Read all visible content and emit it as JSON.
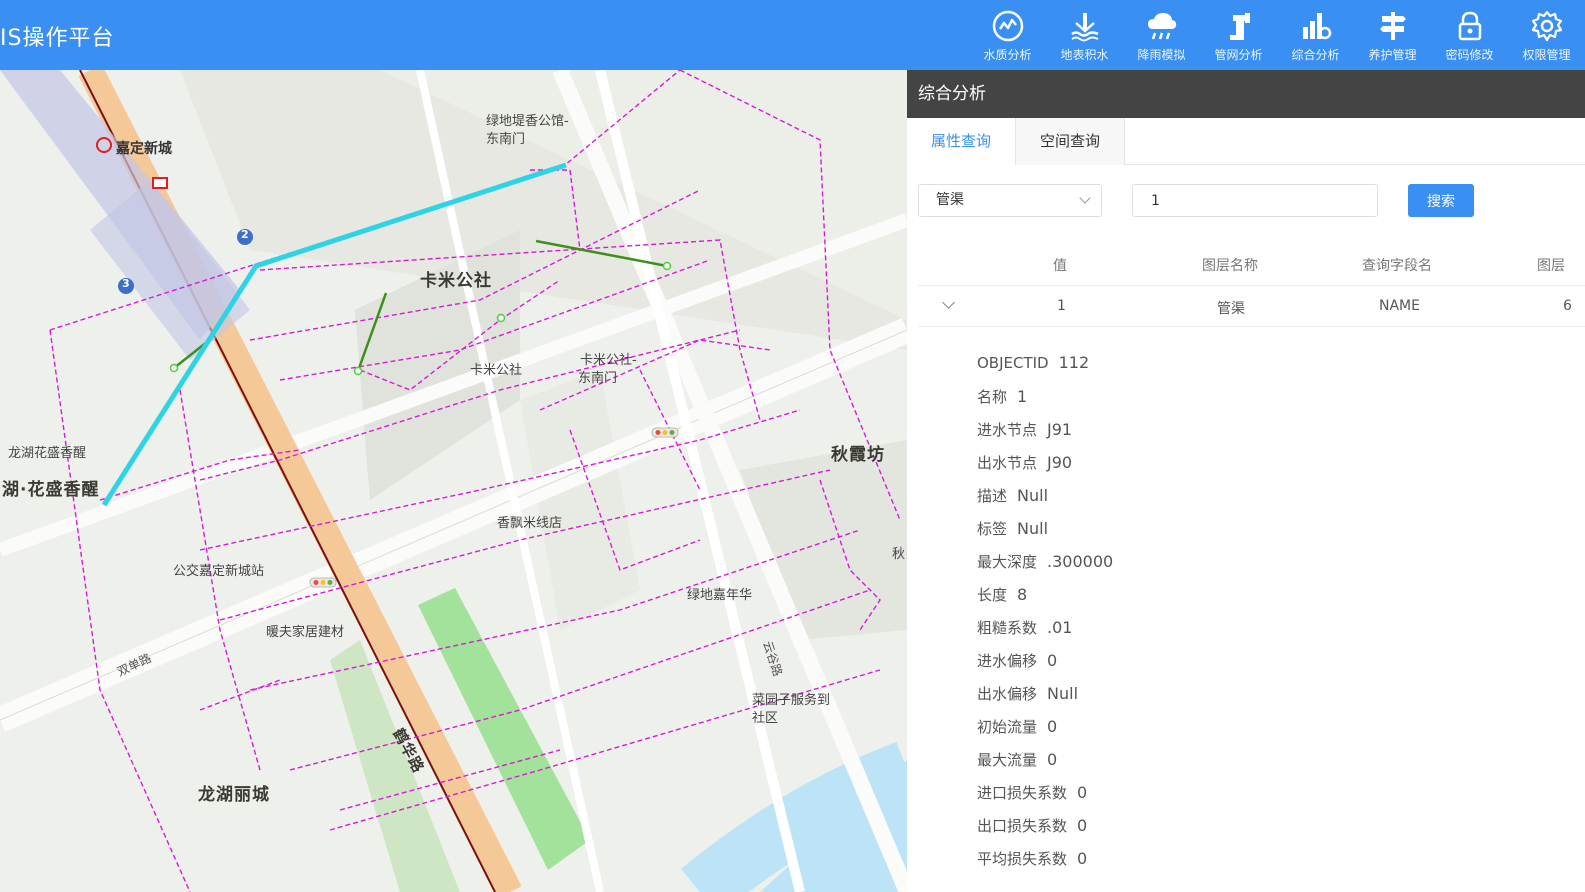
{
  "header": {
    "title": "IS操作平台",
    "nav": [
      {
        "label": "水质分析",
        "icon": "water-quality-icon"
      },
      {
        "label": "地表积水",
        "icon": "surface-water-icon"
      },
      {
        "label": "降雨模拟",
        "icon": "rain-cloud-icon"
      },
      {
        "label": "管网分析",
        "icon": "pipe-network-icon"
      },
      {
        "label": "综合分析",
        "icon": "chart-analysis-icon"
      },
      {
        "label": "养护管理",
        "icon": "signpost-icon"
      },
      {
        "label": "密码修改",
        "icon": "lock-icon"
      },
      {
        "label": "权限管理",
        "icon": "gear-icon"
      }
    ]
  },
  "map": {
    "labels": {
      "jiading_xincheng": "嘉定新城",
      "lvdi_guild": "绿地堤香公馆-",
      "lvdi_guild_gate": "东南门",
      "kami_big": "卡米公社",
      "kami_small": "卡米公社",
      "kami_gate1": "卡米公社-",
      "kami_gate2": "东南门",
      "qiuxia": "秋霞坊",
      "longhu_small": "龙湖花盛香醒",
      "longhu_big": "湖·花盛香醒",
      "xiangpiao": "香飘米线店",
      "bus_station": "公交嘉定新城站",
      "nuanfu": "暖夫家居建材",
      "lvdi_carnival": "绿地嘉年华",
      "caiyuan1": "菜园子服务到",
      "caiyuan2": "社区",
      "shuangdan_rd": "双单路",
      "yunqiu_rd": "云谷路",
      "hehua_rd": "鹤华路",
      "longhu_lily": "龙湖丽城",
      "qiu_edge": "秋",
      "metro_2": "2",
      "metro_3": "3"
    }
  },
  "panel": {
    "title": "综合分析",
    "tabs": [
      "属性查询",
      "空间查询"
    ],
    "layer_select": "管渠",
    "query_value": "1",
    "search_label": "搜索",
    "columns": [
      "值",
      "图层名称",
      "查询字段名",
      "图层"
    ],
    "row": {
      "value": "1",
      "layer": "管渠",
      "field": "NAME",
      "extra": "6"
    },
    "attributes": [
      {
        "k": "OBJECTID",
        "v": "112"
      },
      {
        "k": "名称",
        "v": "1"
      },
      {
        "k": "进水节点",
        "v": "J91"
      },
      {
        "k": "出水节点",
        "v": "J90"
      },
      {
        "k": "描述",
        "v": "Null"
      },
      {
        "k": "标签",
        "v": "Null"
      },
      {
        "k": "最大深度",
        "v": ".300000"
      },
      {
        "k": "长度",
        "v": "8"
      },
      {
        "k": "粗糙系数",
        "v": ".01"
      },
      {
        "k": "进水偏移",
        "v": "0"
      },
      {
        "k": "出水偏移",
        "v": "Null"
      },
      {
        "k": "初始流量",
        "v": "0"
      },
      {
        "k": "最大流量",
        "v": "0"
      },
      {
        "k": "进口损失系数",
        "v": "0"
      },
      {
        "k": "出口损失系数",
        "v": "0"
      },
      {
        "k": "平均损失系数",
        "v": "0"
      }
    ]
  },
  "colors": {
    "accent": "#3a8ff3",
    "panel_header": "#444444",
    "pipe_dashed": "#d81ad8",
    "pipe_highlight": "#2fd3e6",
    "pipe_green": "#3e8f1e"
  }
}
